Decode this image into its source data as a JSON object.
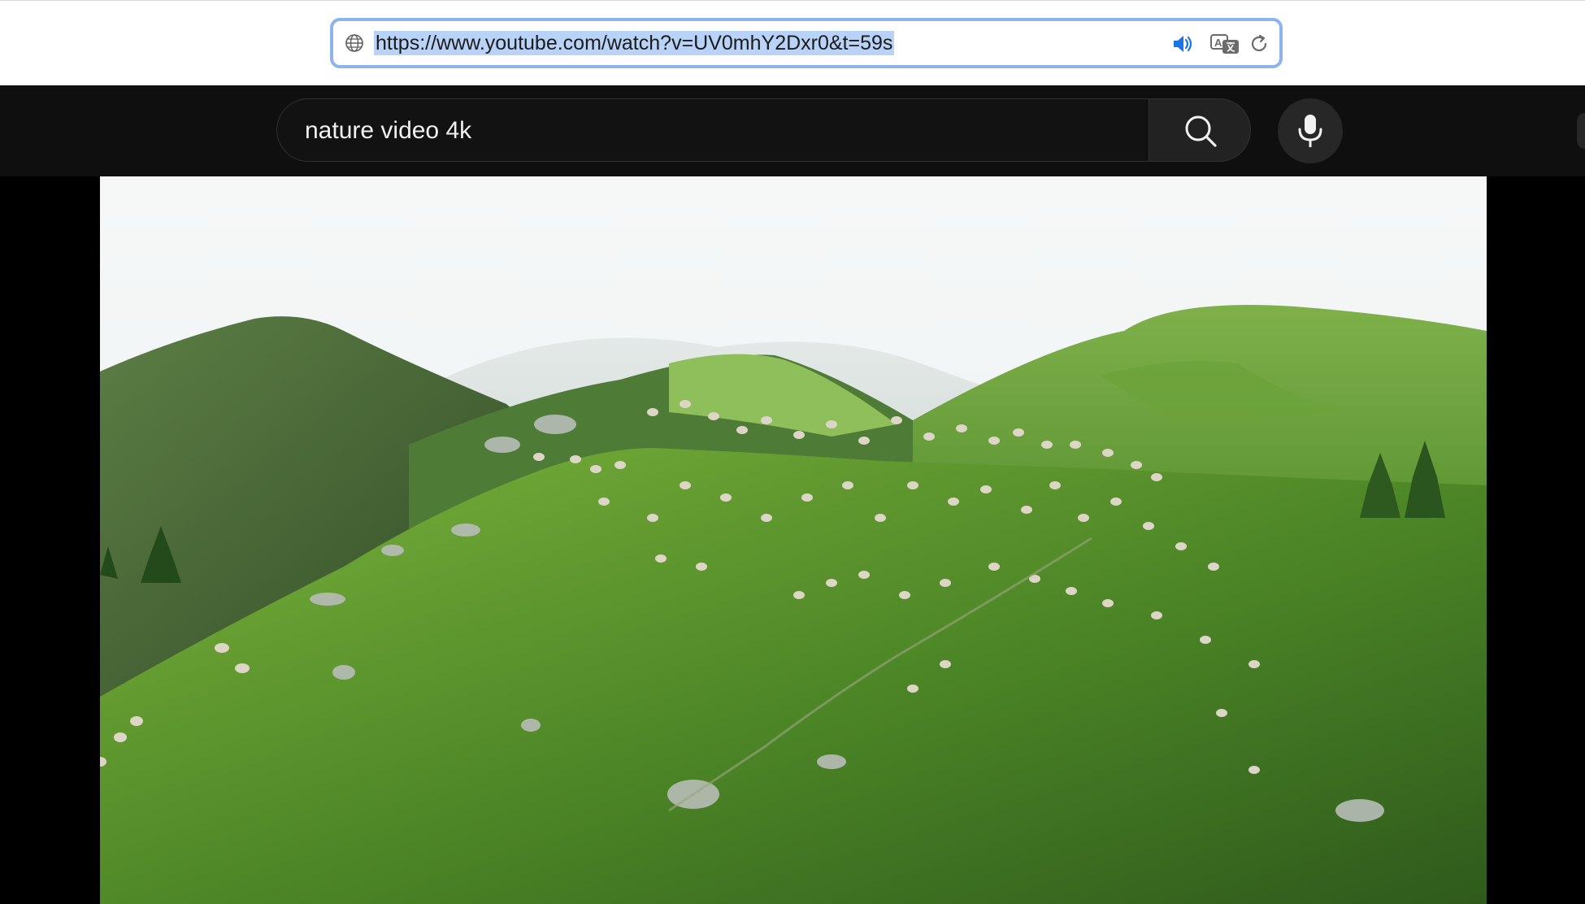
{
  "browser": {
    "address_bar": {
      "url": "https://www.youtube.com/watch?v=UV0mhY2Dxr0&t=59s",
      "icons": [
        "globe-icon",
        "speaker-icon",
        "translate-icon",
        "reload-icon"
      ]
    }
  },
  "youtube": {
    "search": {
      "query": "nature video 4k",
      "icons": [
        "search-icon",
        "microphone-icon"
      ]
    }
  },
  "video": {
    "scene": "green mountain ridge with grazing sheep",
    "colors": {
      "sky": "#f3f6f7",
      "grass": "#5f9a2c",
      "distant_hills": "#3e5a32"
    }
  },
  "colors": {
    "header_bg": "#0f0f0f",
    "search_bg": "#121212",
    "search_button_bg": "#222222",
    "focus_ring": "#8fb4ec",
    "selection": "#b8d3f7",
    "speaker_accent": "#1a73e8"
  }
}
